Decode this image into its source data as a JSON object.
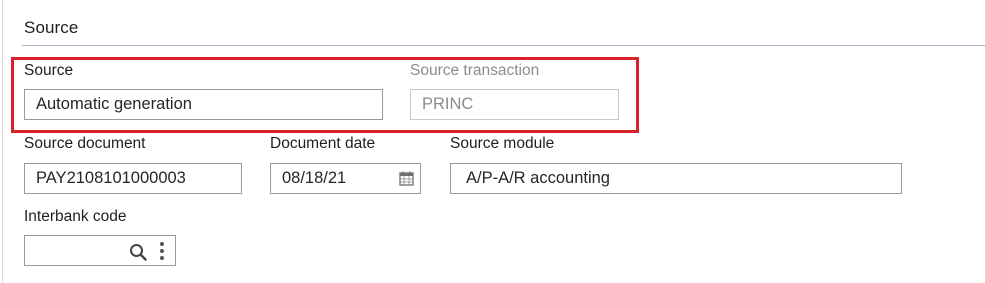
{
  "section": {
    "title": "Source"
  },
  "fields": {
    "source": {
      "label": "Source",
      "value": "Automatic generation"
    },
    "source_transaction": {
      "label": "Source transaction",
      "value": "PRINC"
    },
    "source_document": {
      "label": "Source document",
      "value": "PAY2108101000003"
    },
    "document_date": {
      "label": "Document date",
      "value": "08/18/21"
    },
    "source_module": {
      "label": "Source module",
      "value": "A/P-A/R accounting"
    },
    "interbank_code": {
      "label": "Interbank code",
      "value": ""
    }
  },
  "icons": {
    "calendar": "calendar-icon",
    "search": "search-icon",
    "more": "more-vertical-icon"
  },
  "colors": {
    "highlight": "#d8232a",
    "section_rule": "#a9b6c6",
    "disabled_text": "#8c8c8c"
  }
}
